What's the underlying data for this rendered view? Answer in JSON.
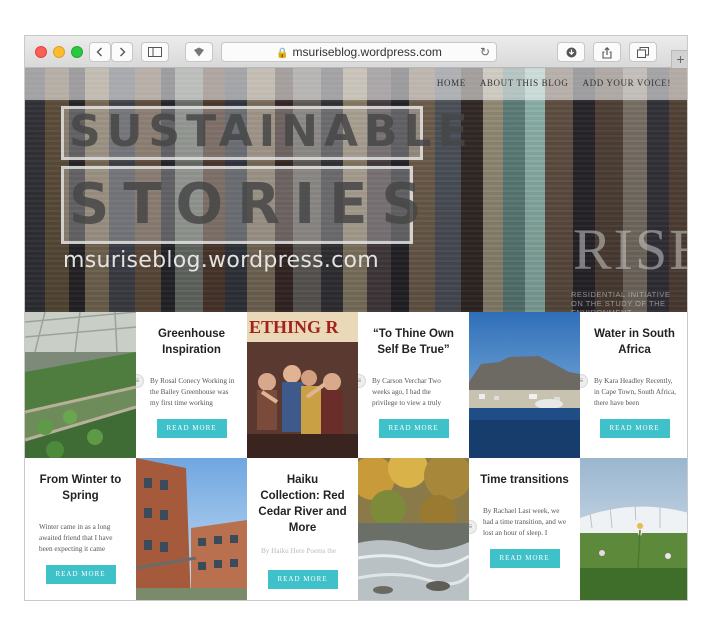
{
  "browser": {
    "url": "msuriseblog.wordpress.com",
    "new_tab": "+"
  },
  "nav": {
    "items": [
      "HOME",
      "ABOUT THIS BLOG",
      "ADD YOUR VOICE!"
    ]
  },
  "hero": {
    "title_line1": "SUSTAINABLE",
    "title_line2": "STORIES",
    "url_text": "msuriseblog.wordpress.com",
    "rise_logo": "RISE",
    "rise_sub": "RESIDENTIAL INITIATIVE ON THE STUDY OF THE ENVIRONMENT"
  },
  "posts": [
    {
      "title": "Greenhouse Inspiration",
      "excerpt": "By Rosal Conecy Working in the Bailey Greenhouse was my first time working",
      "button": "READ MORE"
    },
    {
      "title": "“To Thine Own Self Be True”",
      "excerpt": "By Carson Verchar Two weeks ago, I had the privilege to view a truly",
      "button": "READ MORE"
    },
    {
      "title": "Water in South Africa",
      "excerpt": "By Kara Headley Recently, in Cape Town, South Africa, there have been",
      "button": "READ MORE"
    },
    {
      "title": "From Winter to Spring",
      "excerpt": "Winter came in as a long awaited friend that I have been expecting it came",
      "button": "READ MORE"
    },
    {
      "title": "Haiku Collection: Red Cedar River and More",
      "excerpt": "By Haiku Here Poems the",
      "button": "READ MORE"
    },
    {
      "title": "Time transitions",
      "excerpt": "By Rachael Last week, we had a time transition, and we lost an hour of sleep. I",
      "button": "READ MORE"
    }
  ],
  "photos": {
    "theater_banner": "ETHING R"
  },
  "colors": {
    "accent": "#3fc1c9",
    "title_text": "#222222"
  }
}
